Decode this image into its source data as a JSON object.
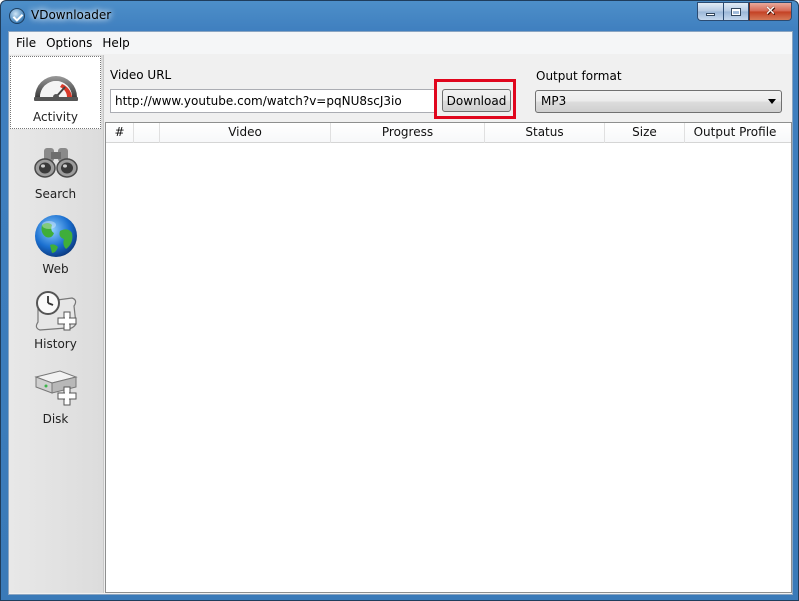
{
  "window": {
    "title": "VDownloader",
    "icon": "app-logo-icon",
    "controls": {
      "minimize": "minimize-icon",
      "maximize": "maximize-icon",
      "close": "close-icon"
    }
  },
  "menu": {
    "items": [
      {
        "label": "File"
      },
      {
        "label": "Options"
      },
      {
        "label": "Help"
      }
    ]
  },
  "sidebar": {
    "items": [
      {
        "label": "Activity",
        "icon": "gauge-icon",
        "active": true
      },
      {
        "label": "Search",
        "icon": "binoculars-icon",
        "active": false
      },
      {
        "label": "Web",
        "icon": "globe-icon",
        "active": false
      },
      {
        "label": "History",
        "icon": "clock-scroll-icon",
        "active": false
      },
      {
        "label": "Disk",
        "icon": "disk-drive-icon",
        "active": false
      }
    ]
  },
  "main": {
    "url_label": "Video URL",
    "url_value": "http://www.youtube.com/watch?v=pqNU8scJ3io",
    "download_label": "Download",
    "format_label": "Output format",
    "format_value": "MP3",
    "highlight_color": "#e0061d",
    "table": {
      "columns": [
        "#",
        "",
        "Video",
        "Progress",
        "Status",
        "Size",
        "Output Profile"
      ],
      "rows": []
    }
  }
}
